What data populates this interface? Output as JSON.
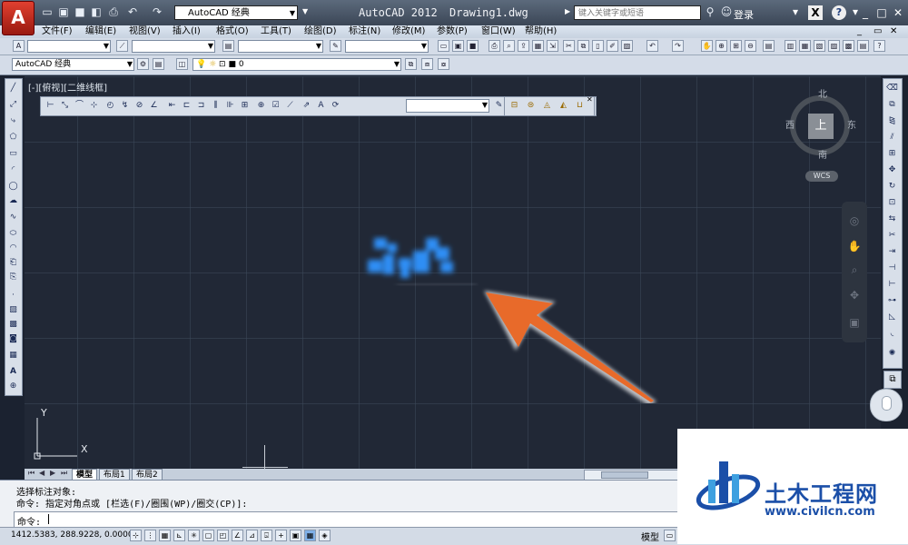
{
  "titlebar": {
    "app_logo": "A",
    "workspace": "AutoCAD 经典",
    "app_title": "AutoCAD 2012",
    "doc_title": "Drawing1.dwg",
    "search_placeholder": "键入关键字或短语",
    "login": "登录"
  },
  "menu": [
    "文件(F)",
    "编辑(E)",
    "视图(V)",
    "插入(I)",
    "格式(O)",
    "工具(T)",
    "绘图(D)",
    "标注(N)",
    "修改(M)",
    "参数(P)",
    "窗口(W)",
    "帮助(H)"
  ],
  "toolbar2": {
    "workspace_combo": "AutoCAD 经典",
    "layer_combo": "0"
  },
  "canvas": {
    "viewport_label": "[-][俯视][二维线框]",
    "ucs_y": "Y",
    "ucs_x": "X"
  },
  "viewcube": {
    "north": "北",
    "south": "南",
    "east": "东",
    "west": "西",
    "top_face": "上",
    "wcs": "WCS"
  },
  "tabs": [
    "模型",
    "布局1",
    "布局2"
  ],
  "command": {
    "line1": "选择标注对象:",
    "line2": "命令: 指定对角点或 [栏选(F)/圈围(WP)/圈交(CP)]:",
    "prompt": "命令:"
  },
  "status": {
    "coords": "1412.5383, 288.9228, 0.0000",
    "model": "模型"
  },
  "watermark": {
    "name": "土木工程网",
    "url": "www.civilcn.com"
  },
  "colors": {
    "canvas_bg": "#212836",
    "selection_blue": "#2f8ef5",
    "arrow_orange": "#e86a2a"
  }
}
